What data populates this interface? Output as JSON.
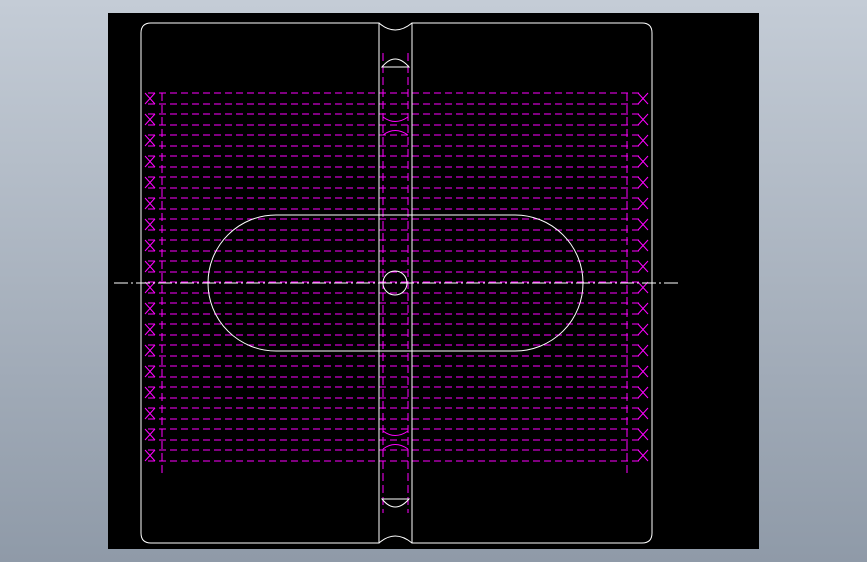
{
  "app": {
    "background_gradient_top": "#c4ccd6",
    "background_gradient_bottom": "#8f9aa8"
  },
  "drawing": {
    "canvas_color": "#000000",
    "outline_color": "#ffffff",
    "hidden_line_color": "#ff00ff",
    "centerline_color": "#ffffff",
    "has_slot": true,
    "has_center_hole": true,
    "has_centerline": true,
    "has_hidden_lines": true
  }
}
